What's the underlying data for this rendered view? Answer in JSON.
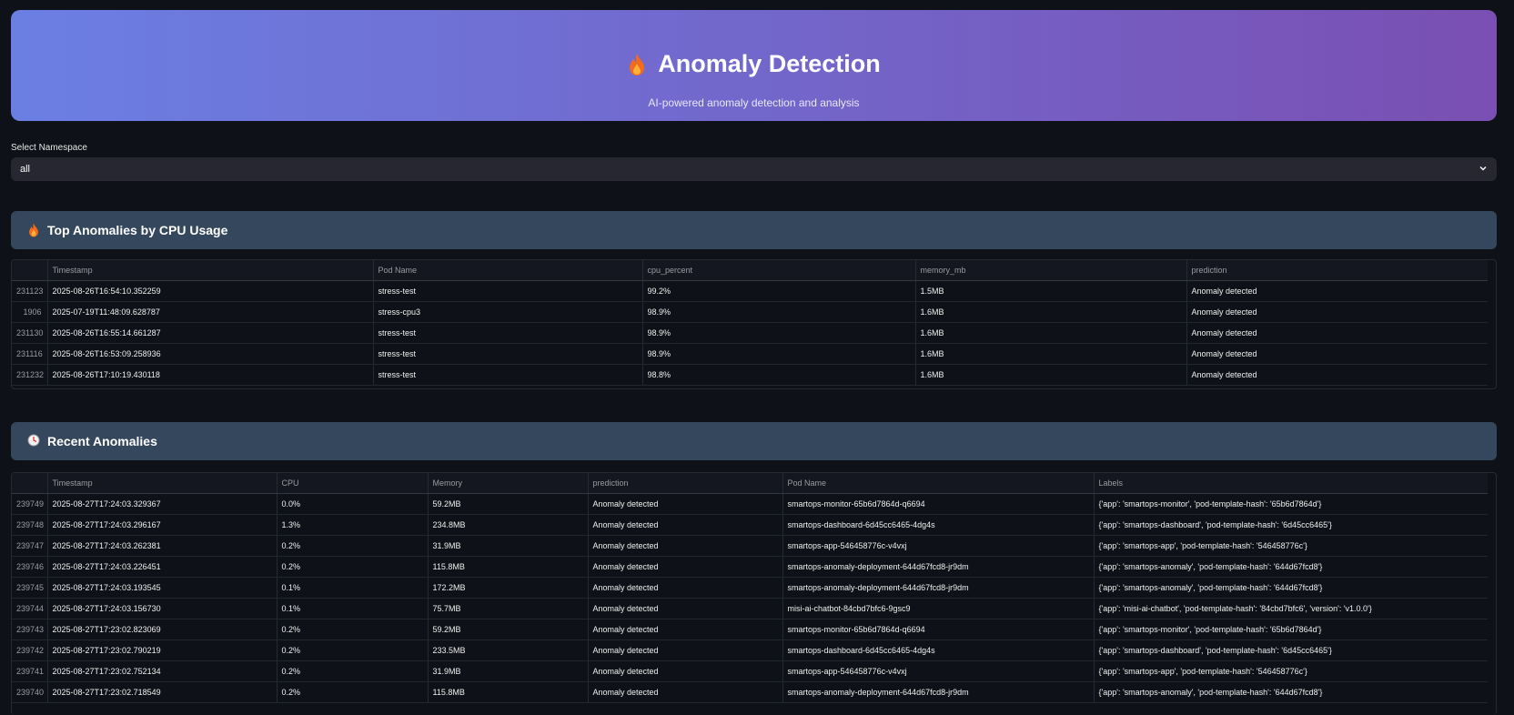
{
  "header": {
    "title": "Anomaly Detection",
    "subtitle": "AI-powered anomaly detection and analysis",
    "gradient_start": "#6b7fe3",
    "gradient_end": "#7a4fb3",
    "icon": "flame-icon"
  },
  "namespace": {
    "label": "Select Namespace",
    "value": "all"
  },
  "top_anomalies": {
    "title": "Top Anomalies by CPU Usage",
    "icon": "flame-icon",
    "columns": [
      "",
      "Timestamp",
      "Pod Name",
      "cpu_percent",
      "memory_mb",
      "prediction"
    ],
    "rows": [
      [
        "231123",
        "2025-08-26T16:54:10.352259",
        "stress-test",
        "99.2%",
        "1.5MB",
        "Anomaly detected"
      ],
      [
        "1906",
        "2025-07-19T11:48:09.628787",
        "stress-cpu3",
        "98.9%",
        "1.6MB",
        "Anomaly detected"
      ],
      [
        "231130",
        "2025-08-26T16:55:14.661287",
        "stress-test",
        "98.9%",
        "1.6MB",
        "Anomaly detected"
      ],
      [
        "231116",
        "2025-08-26T16:53:09.258936",
        "stress-test",
        "98.9%",
        "1.6MB",
        "Anomaly detected"
      ],
      [
        "231232",
        "2025-08-26T17:10:19.430118",
        "stress-test",
        "98.8%",
        "1.6MB",
        "Anomaly detected"
      ]
    ]
  },
  "recent_anomalies": {
    "title": "Recent Anomalies",
    "icon": "clock-icon",
    "columns": [
      "",
      "Timestamp",
      "CPU",
      "Memory",
      "prediction",
      "Pod Name",
      "Labels"
    ],
    "rows": [
      [
        "239749",
        "2025-08-27T17:24:03.329367",
        "0.0%",
        "59.2MB",
        "Anomaly detected",
        "smartops-monitor-65b6d7864d-q6694",
        "{'app': 'smartops-monitor', 'pod-template-hash': '65b6d7864d'}"
      ],
      [
        "239748",
        "2025-08-27T17:24:03.296167",
        "1.3%",
        "234.8MB",
        "Anomaly detected",
        "smartops-dashboard-6d45cc6465-4dg4s",
        "{'app': 'smartops-dashboard', 'pod-template-hash': '6d45cc6465'}"
      ],
      [
        "239747",
        "2025-08-27T17:24:03.262381",
        "0.2%",
        "31.9MB",
        "Anomaly detected",
        "smartops-app-546458776c-v4vxj",
        "{'app': 'smartops-app', 'pod-template-hash': '546458776c'}"
      ],
      [
        "239746",
        "2025-08-27T17:24:03.226451",
        "0.2%",
        "115.8MB",
        "Anomaly detected",
        "smartops-anomaly-deployment-644d67fcd8-jr9dm",
        "{'app': 'smartops-anomaly', 'pod-template-hash': '644d67fcd8'}"
      ],
      [
        "239745",
        "2025-08-27T17:24:03.193545",
        "0.1%",
        "172.2MB",
        "Anomaly detected",
        "smartops-anomaly-deployment-644d67fcd8-jr9dm",
        "{'app': 'smartops-anomaly', 'pod-template-hash': '644d67fcd8'}"
      ],
      [
        "239744",
        "2025-08-27T17:24:03.156730",
        "0.1%",
        "75.7MB",
        "Anomaly detected",
        "misi-ai-chatbot-84cbd7bfc6-9gsc9",
        "{'app': 'misi-ai-chatbot', 'pod-template-hash': '84cbd7bfc6', 'version': 'v1.0.0'}"
      ],
      [
        "239743",
        "2025-08-27T17:23:02.823069",
        "0.2%",
        "59.2MB",
        "Anomaly detected",
        "smartops-monitor-65b6d7864d-q6694",
        "{'app': 'smartops-monitor', 'pod-template-hash': '65b6d7864d'}"
      ],
      [
        "239742",
        "2025-08-27T17:23:02.790219",
        "0.2%",
        "233.5MB",
        "Anomaly detected",
        "smartops-dashboard-6d45cc6465-4dg4s",
        "{'app': 'smartops-dashboard', 'pod-template-hash': '6d45cc6465'}"
      ],
      [
        "239741",
        "2025-08-27T17:23:02.752134",
        "0.2%",
        "31.9MB",
        "Anomaly detected",
        "smartops-app-546458776c-v4vxj",
        "{'app': 'smartops-app', 'pod-template-hash': '546458776c'}"
      ],
      [
        "239740",
        "2025-08-27T17:23:02.718549",
        "0.2%",
        "115.8MB",
        "Anomaly detected",
        "smartops-anomaly-deployment-644d67fcd8-jr9dm",
        "{'app': 'smartops-anomaly', 'pod-template-hash': '644d67fcd8'}"
      ]
    ]
  }
}
